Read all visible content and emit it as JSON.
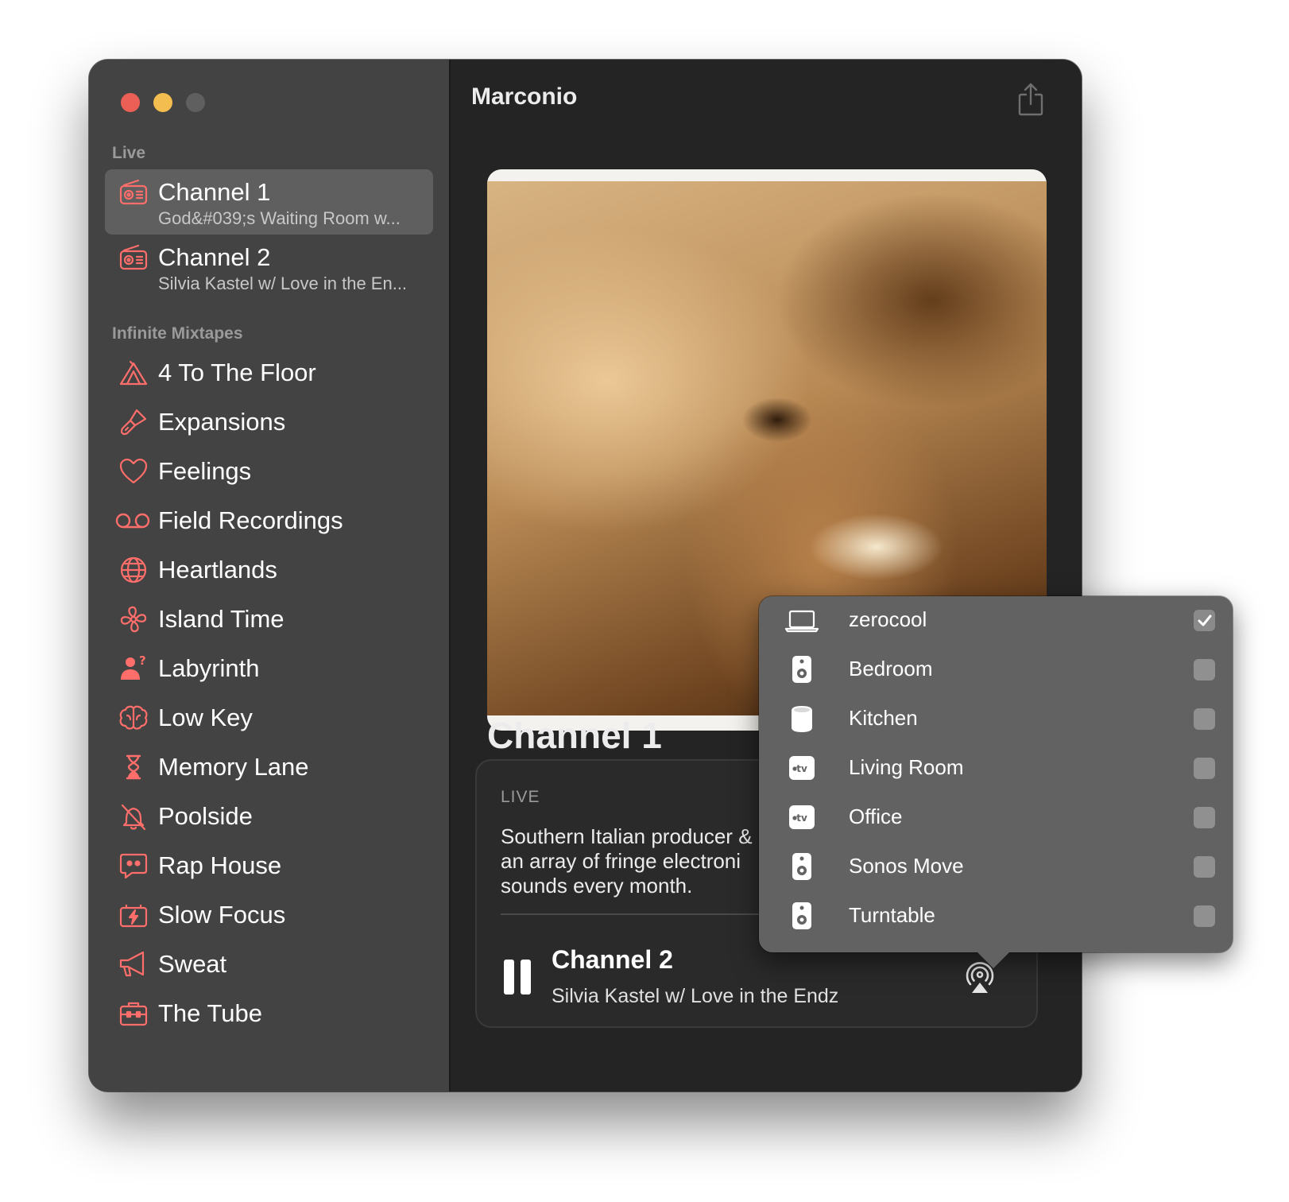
{
  "window": {
    "title": "Marconio",
    "traffic_lights": [
      "close",
      "minimize",
      "zoom"
    ]
  },
  "sidebar": {
    "live_section": {
      "label": "Live",
      "items": [
        {
          "title": "Channel 1",
          "subtitle": "God&#039;s Waiting Room w...",
          "icon": "radio-icon",
          "selected": true
        },
        {
          "title": "Channel 2",
          "subtitle": "Silvia Kastel w/ Love in the En...",
          "icon": "radio-icon",
          "selected": false
        }
      ]
    },
    "mixtapes_section": {
      "label": "Infinite Mixtapes",
      "items": [
        {
          "title": "4 To The Floor",
          "icon": "tent-icon"
        },
        {
          "title": "Expansions",
          "icon": "paintbrush-icon"
        },
        {
          "title": "Feelings",
          "icon": "heart-icon"
        },
        {
          "title": "Field Recordings",
          "icon": "voicemail-icon"
        },
        {
          "title": "Heartlands",
          "icon": "globe-icon"
        },
        {
          "title": "Island Time",
          "icon": "fan-icon"
        },
        {
          "title": "Labyrinth",
          "icon": "person-question-icon"
        },
        {
          "title": "Low Key",
          "icon": "brain-icon"
        },
        {
          "title": "Memory Lane",
          "icon": "hourglass-icon"
        },
        {
          "title": "Poolside",
          "icon": "bell-slash-icon"
        },
        {
          "title": "Rap House",
          "icon": "quote-bubble-icon"
        },
        {
          "title": "Slow Focus",
          "icon": "battery-bolt-icon"
        },
        {
          "title": "Sweat",
          "icon": "megaphone-icon"
        },
        {
          "title": "The Tube",
          "icon": "toolbox-icon"
        }
      ]
    }
  },
  "main": {
    "title": "Marconio",
    "share_icon": "share-icon",
    "channel_title": "Channel 1",
    "card": {
      "live_label": "LIVE",
      "description": "Southern Italian producer &\nan array of fringe electroni\nsounds every month."
    },
    "now_playing": {
      "title": "Channel 2",
      "subtitle": "Silvia Kastel w/ Love in the Endz",
      "pause_icon": "pause-icon",
      "airplay_icon": "airplay-icon"
    }
  },
  "airplay_menu": {
    "devices": [
      {
        "name": "zerocool",
        "icon": "laptop-icon",
        "checked": true
      },
      {
        "name": "Bedroom",
        "icon": "speaker-icon",
        "checked": false
      },
      {
        "name": "Kitchen",
        "icon": "homepod-icon",
        "checked": false
      },
      {
        "name": "Living Room",
        "icon": "appletv-icon",
        "checked": false
      },
      {
        "name": "Office",
        "icon": "appletv-icon",
        "checked": false
      },
      {
        "name": "Sonos Move",
        "icon": "speaker-icon",
        "checked": false
      },
      {
        "name": "Turntable",
        "icon": "speaker-icon",
        "checked": false
      }
    ]
  },
  "colors": {
    "accent": "#ff6e6a",
    "sidebar_bg": "#434343",
    "sidebar_selected": "#5f5f5f",
    "main_bg": "#242424",
    "popover_bg": "#626262"
  }
}
